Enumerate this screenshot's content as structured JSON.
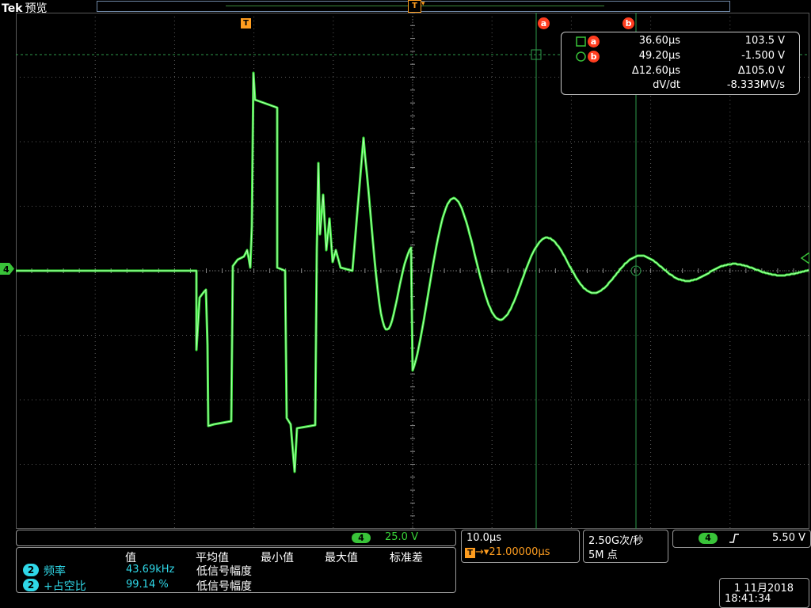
{
  "header": {
    "brand": "Tek",
    "mode": "预览",
    "trigger_marker": "T",
    "record_marker": "T"
  },
  "cursors": {
    "a_label": "a",
    "b_label": "b"
  },
  "channel_marker": "4",
  "measurement": {
    "a": {
      "time": "36.60µs",
      "value": "103.5 V"
    },
    "b": {
      "time": "49.20µs",
      "value": "-1.500 V"
    },
    "delta": {
      "time": "Δ12.60µs",
      "value": "Δ105.0 V"
    },
    "rate": {
      "label": "dV/dt",
      "value": "-8.333MV/s"
    }
  },
  "bottom": {
    "ch4_badge": "4",
    "ch4_scale": "25.0 V",
    "timebase": "10.0µs",
    "trigger_delay": "21.00000µs",
    "trigger_delay_prefix": "T",
    "sample_rate": "2.50G次/秒",
    "record_length": "5M 点",
    "trigger_channel": "4",
    "trigger_level": "5.50 V",
    "date": "1 11月2018",
    "time": "18:41:34"
  },
  "stats": {
    "headers": [
      "值",
      "平均值",
      "最小值",
      "最大值",
      "标准差"
    ],
    "rows": [
      {
        "ch": "2",
        "name": "频率",
        "value": "43.69kHz",
        "status": "低信号幅度"
      },
      {
        "ch": "2",
        "name": "+占空比",
        "value": "99.14 %",
        "status": "低信号幅度"
      }
    ]
  },
  "colors": {
    "trace": "#39e639",
    "grid": "#5a5a5a",
    "cursor": "#2e9a4a",
    "accent": "#ff9d1f",
    "cursor_label": "#ff3d1f",
    "stats_text": "#2fd8e8"
  }
}
